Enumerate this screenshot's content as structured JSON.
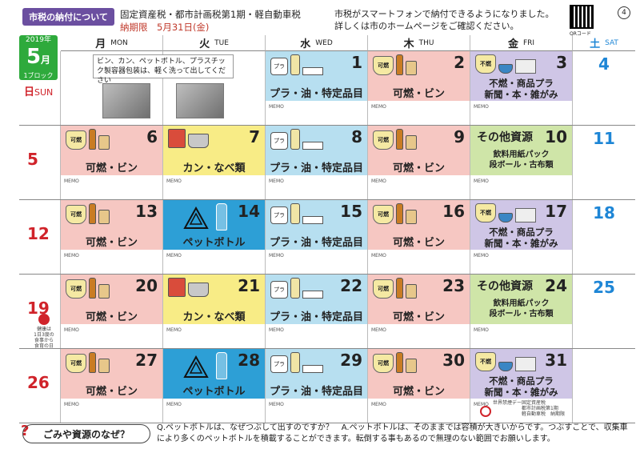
{
  "header": {
    "notice_title": "市税の納付について",
    "tax_title": "固定資産税・都市計画税第1期・軽自動車税",
    "tax_deadline": "納期限　5月31日(金)",
    "smartphone_line1": "市税がスマートフォンで納付できるようになりました。",
    "smartphone_line2": "詳しくは市のホームページをご確認ください。",
    "qr_label": "QRコード",
    "page_number": "4"
  },
  "month_badge": {
    "year": "2019年",
    "month": "5",
    "month_unit": "月",
    "block": "1ブロック"
  },
  "weekdays": [
    {
      "jp": "日",
      "en": "SUN"
    },
    {
      "jp": "月",
      "en": "MON"
    },
    {
      "jp": "火",
      "en": "TUE"
    },
    {
      "jp": "水",
      "en": "WED"
    },
    {
      "jp": "木",
      "en": "THU"
    },
    {
      "jp": "金",
      "en": "FRI"
    },
    {
      "jp": "土",
      "en": "SAT"
    }
  ],
  "memo_label": "MEMO",
  "note_box": "ビン、カン、ペットボトル、プラスチック製容器包装は、軽く洗って出してください",
  "categories": {
    "burnable_bottle": "可燃・ビン",
    "plastic_oil": "プラ・油・特定品目",
    "cans_pots": "カン・なべ類",
    "pet_bottle": "ペットボトル",
    "nonburn_a": "不燃・商品プラ",
    "nonburn_b": "新聞・本・雑がみ",
    "other_res": "その他資源",
    "other_sub1": "飲料用紙パック",
    "other_sub2": "段ボール・古布類"
  },
  "icon_labels": {
    "burnable": "可燃",
    "nonburn": "不燃",
    "pla": "プラ"
  },
  "weeks": [
    {
      "sun": "",
      "mon": "",
      "tue": "",
      "wed": "1",
      "thu": "2",
      "fri": "3",
      "sat": "4"
    },
    {
      "sun": "5",
      "mon": "6",
      "tue": "7",
      "wed": "8",
      "thu": "9",
      "fri": "10",
      "sat": "11"
    },
    {
      "sun": "12",
      "mon": "13",
      "tue": "14",
      "wed": "15",
      "thu": "16",
      "fri": "17",
      "sat": "18"
    },
    {
      "sun": "19",
      "mon": "20",
      "tue": "21",
      "wed": "22",
      "thu": "23",
      "fri": "24",
      "sat": "25"
    },
    {
      "sun": "26",
      "mon": "27",
      "tue": "28",
      "wed": "29",
      "thu": "30",
      "fri": "31",
      "sat": ""
    }
  ],
  "health": {
    "line1": "健康は",
    "line2": "1日3度の食事から",
    "line3": "食育の日"
  },
  "footer": {
    "q_label": "ごみや資源のなぜ？",
    "text": "Q.ペットボトルは、なぜつぶして出すのですか？　A.ペットボトルは、そのままでは容積が大きいからです。つぶすことで、収集車により多くのペットボトルを積載することができます。転倒する事もあるので無理のない範囲でお願いします。"
  },
  "marks": {
    "nosmoke_label": "世界禁煙デー",
    "tax_label1": "固定資産税",
    "tax_label2": "都市計画税第1期",
    "tax_label3": "軽自動車税　納期限"
  },
  "colors": {
    "burnable": "#f6c7c2",
    "plastic": "#b7dff0",
    "cans": "#f8ec86",
    "pet": "#2d9fd6",
    "nonburn": "#cfc6e6",
    "other": "#cfe5a8",
    "sunday": "#d0232a",
    "saturday": "#1e86d6",
    "badge": "#2eaa3c"
  }
}
